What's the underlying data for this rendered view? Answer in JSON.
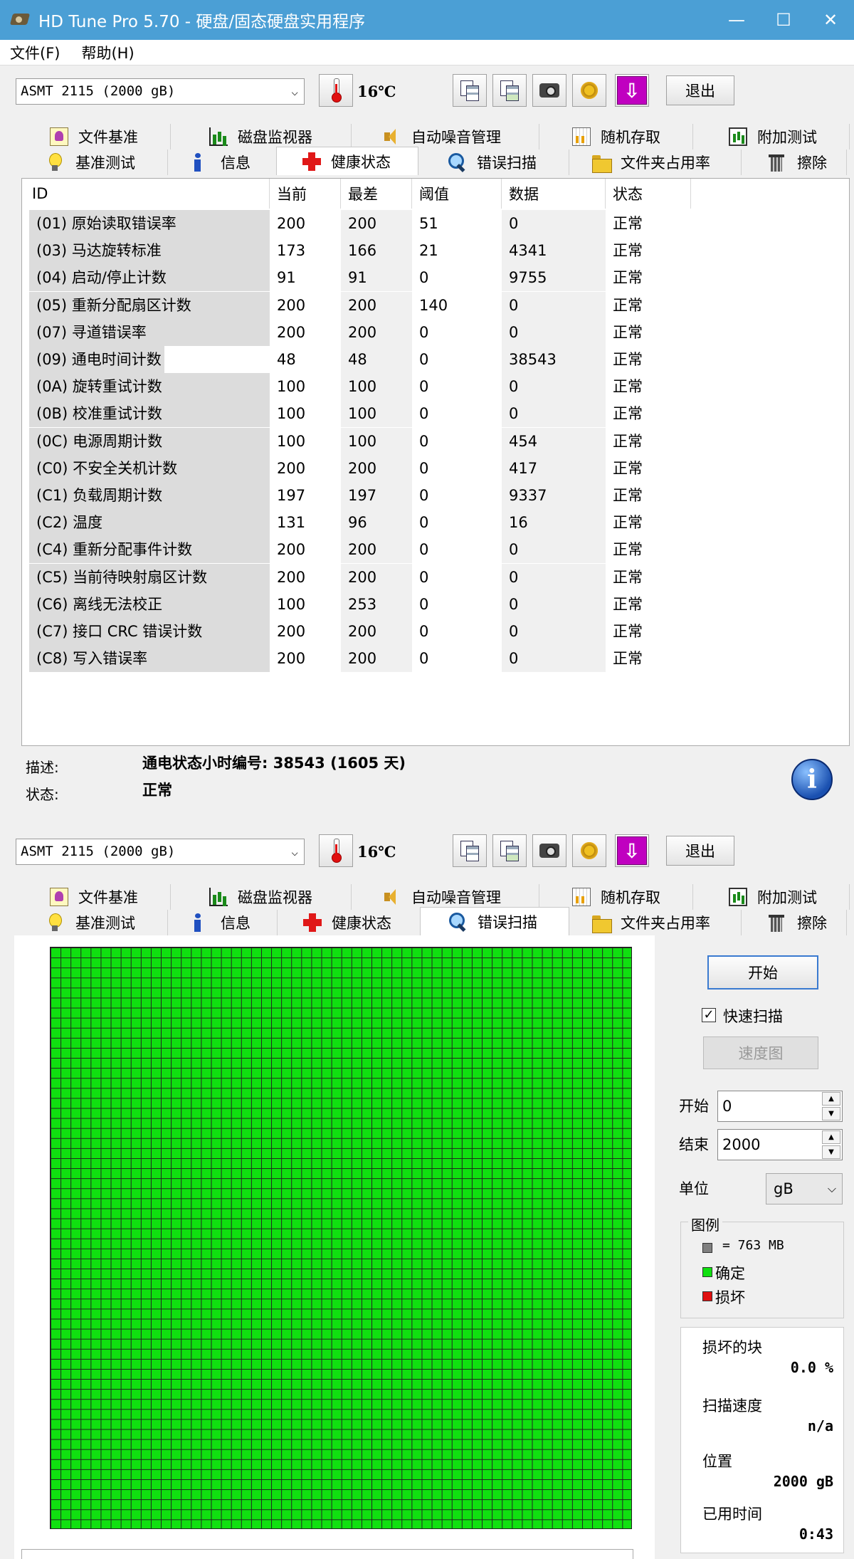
{
  "window": {
    "title": "HD Tune Pro 5.70 - 硬盘/固态硬盘实用程序",
    "minimize": "—",
    "maximize": "☐",
    "close": "✕"
  },
  "menu": {
    "file": "文件(F)",
    "help": "帮助(H)"
  },
  "toolbar": {
    "drive": "ASMT    2115 (2000 gB)",
    "temperature": "16℃",
    "exit": "退出"
  },
  "tabs": {
    "row1": [
      "文件基准",
      "磁盘监视器",
      "自动噪音管理",
      "随机存取",
      "附加测试"
    ],
    "row2": [
      "基准测试",
      "信息",
      "健康状态",
      "错误扫描",
      "文件夹占用率",
      "擦除"
    ]
  },
  "health": {
    "headers": [
      "ID",
      "当前",
      "最差",
      "阈值",
      "数据",
      "状态"
    ],
    "rows": [
      [
        "(01) 原始读取错误率",
        "200",
        "200",
        "51",
        "0",
        "正常"
      ],
      [
        "(03) 马达旋转标准",
        "173",
        "166",
        "21",
        "4341",
        "正常"
      ],
      [
        "(04) 启动/停止计数",
        "91",
        "91",
        "0",
        "9755",
        "正常"
      ],
      [
        "(05) 重新分配扇区计数",
        "200",
        "200",
        "140",
        "0",
        "正常"
      ],
      [
        "(07) 寻道错误率",
        "200",
        "200",
        "0",
        "0",
        "正常"
      ],
      [
        "(09) 通电时间计数",
        "48",
        "48",
        "0",
        "38543",
        "正常"
      ],
      [
        "(0A) 旋转重试计数",
        "100",
        "100",
        "0",
        "0",
        "正常"
      ],
      [
        "(0B) 校准重试计数",
        "100",
        "100",
        "0",
        "0",
        "正常"
      ],
      [
        "(0C) 电源周期计数",
        "100",
        "100",
        "0",
        "454",
        "正常"
      ],
      [
        "(C0) 不安全关机计数",
        "200",
        "200",
        "0",
        "417",
        "正常"
      ],
      [
        "(C1) 负载周期计数",
        "197",
        "197",
        "0",
        "9337",
        "正常"
      ],
      [
        "(C2) 温度",
        "131",
        "96",
        "0",
        "16",
        "正常"
      ],
      [
        "(C4) 重新分配事件计数",
        "200",
        "200",
        "0",
        "0",
        "正常"
      ],
      [
        "(C5) 当前待映射扇区计数",
        "200",
        "200",
        "0",
        "0",
        "正常"
      ],
      [
        "(C6) 离线无法校正",
        "100",
        "253",
        "0",
        "0",
        "正常"
      ],
      [
        "(C7) 接口 CRC 错误计数",
        "200",
        "200",
        "0",
        "0",
        "正常"
      ],
      [
        "(C8) 写入错误率",
        "200",
        "200",
        "0",
        "0",
        "正常"
      ]
    ],
    "desc_label": "描述:",
    "desc_value": "通电状态小时编号: 38543 (1605 天)",
    "status_label": "状态:",
    "status_value": "正常",
    "info_icon": "i"
  },
  "scan": {
    "start": "开始",
    "quick_scan": "快速扫描",
    "quick_checked": "✓",
    "speed_map": "速度图",
    "start_label": "开始",
    "start_value": "0",
    "end_label": "结束",
    "end_value": "2000",
    "unit_label": "单位",
    "unit_value": "gB",
    "legend_title": "图例",
    "legend_block": "= 763 MB",
    "legend_ok": "确定",
    "legend_bad": "损坏",
    "bad_blocks_label": "损坏的块",
    "bad_blocks_value": "0.0 %",
    "speed_label": "扫描速度",
    "speed_value": "n/a",
    "position_label": "位置",
    "position_value": "2000 gB",
    "elapsed_label": "已用时间",
    "elapsed_value": "0:43",
    "colors": {
      "ok": "#10e010",
      "bad": "#e01010",
      "block": "#808080"
    }
  }
}
